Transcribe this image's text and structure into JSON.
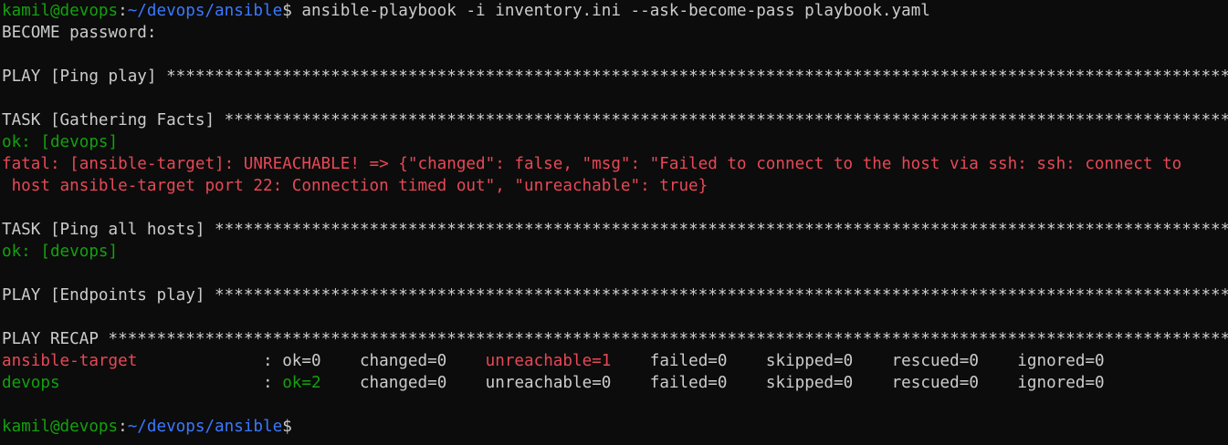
{
  "prompt": {
    "user_host": "kamil@devops",
    "sep": ":",
    "path": "~/devops/ansible",
    "symbol": "$"
  },
  "command": " ansible-playbook -i inventory.ini --ask-become-pass playbook.yaml",
  "become_prompt": "BECOME password:",
  "stars": "************************************************************************************************************************************************************************",
  "play_ping": "PLAY [Ping play] ",
  "task_gather": "TASK [Gathering Facts] ",
  "ok_devops_1": "ok: [devops]",
  "fatal_line1": "fatal: [ansible-target]: UNREACHABLE! => {\"changed\": false, \"msg\": \"Failed to connect to the host via ssh: ssh: connect to",
  "fatal_line2": " host ansible-target port 22: Connection timed out\", \"unreachable\": true}",
  "task_ping_all": "TASK [Ping all hosts] ",
  "ok_devops_2": "ok: [devops]",
  "play_endpoints": "PLAY [Endpoints play] ",
  "play_recap": "PLAY RECAP ",
  "recap": {
    "ansible_target": {
      "host": "ansible-target",
      "pad": "             ",
      "colon": ": ",
      "ok": "ok=0",
      "sp1": "    ",
      "changed": "changed=0",
      "sp2": "    ",
      "unreachable": "unreachable=1",
      "sp3": "    ",
      "failed": "failed=0",
      "sp4": "    ",
      "skipped": "skipped=0",
      "sp5": "    ",
      "rescued": "rescued=0",
      "sp6": "    ",
      "ignored": "ignored=0"
    },
    "devops": {
      "host": "devops",
      "pad": "                     ",
      "colon": ": ",
      "ok": "ok=2",
      "sp1": "    ",
      "changed": "changed=0",
      "sp2": "    ",
      "unreachable": "unreachable=0",
      "sp3": "    ",
      "failed": "failed=0",
      "sp4": "    ",
      "skipped": "skipped=0",
      "sp5": "    ",
      "rescued": "rescued=0",
      "sp6": "    ",
      "ignored": "ignored=0"
    }
  },
  "colors": {
    "background": "#0c0c0c",
    "foreground": "#cccccc",
    "green": "#13a10e",
    "red": "#e74856",
    "blue": "#3b78ff"
  }
}
